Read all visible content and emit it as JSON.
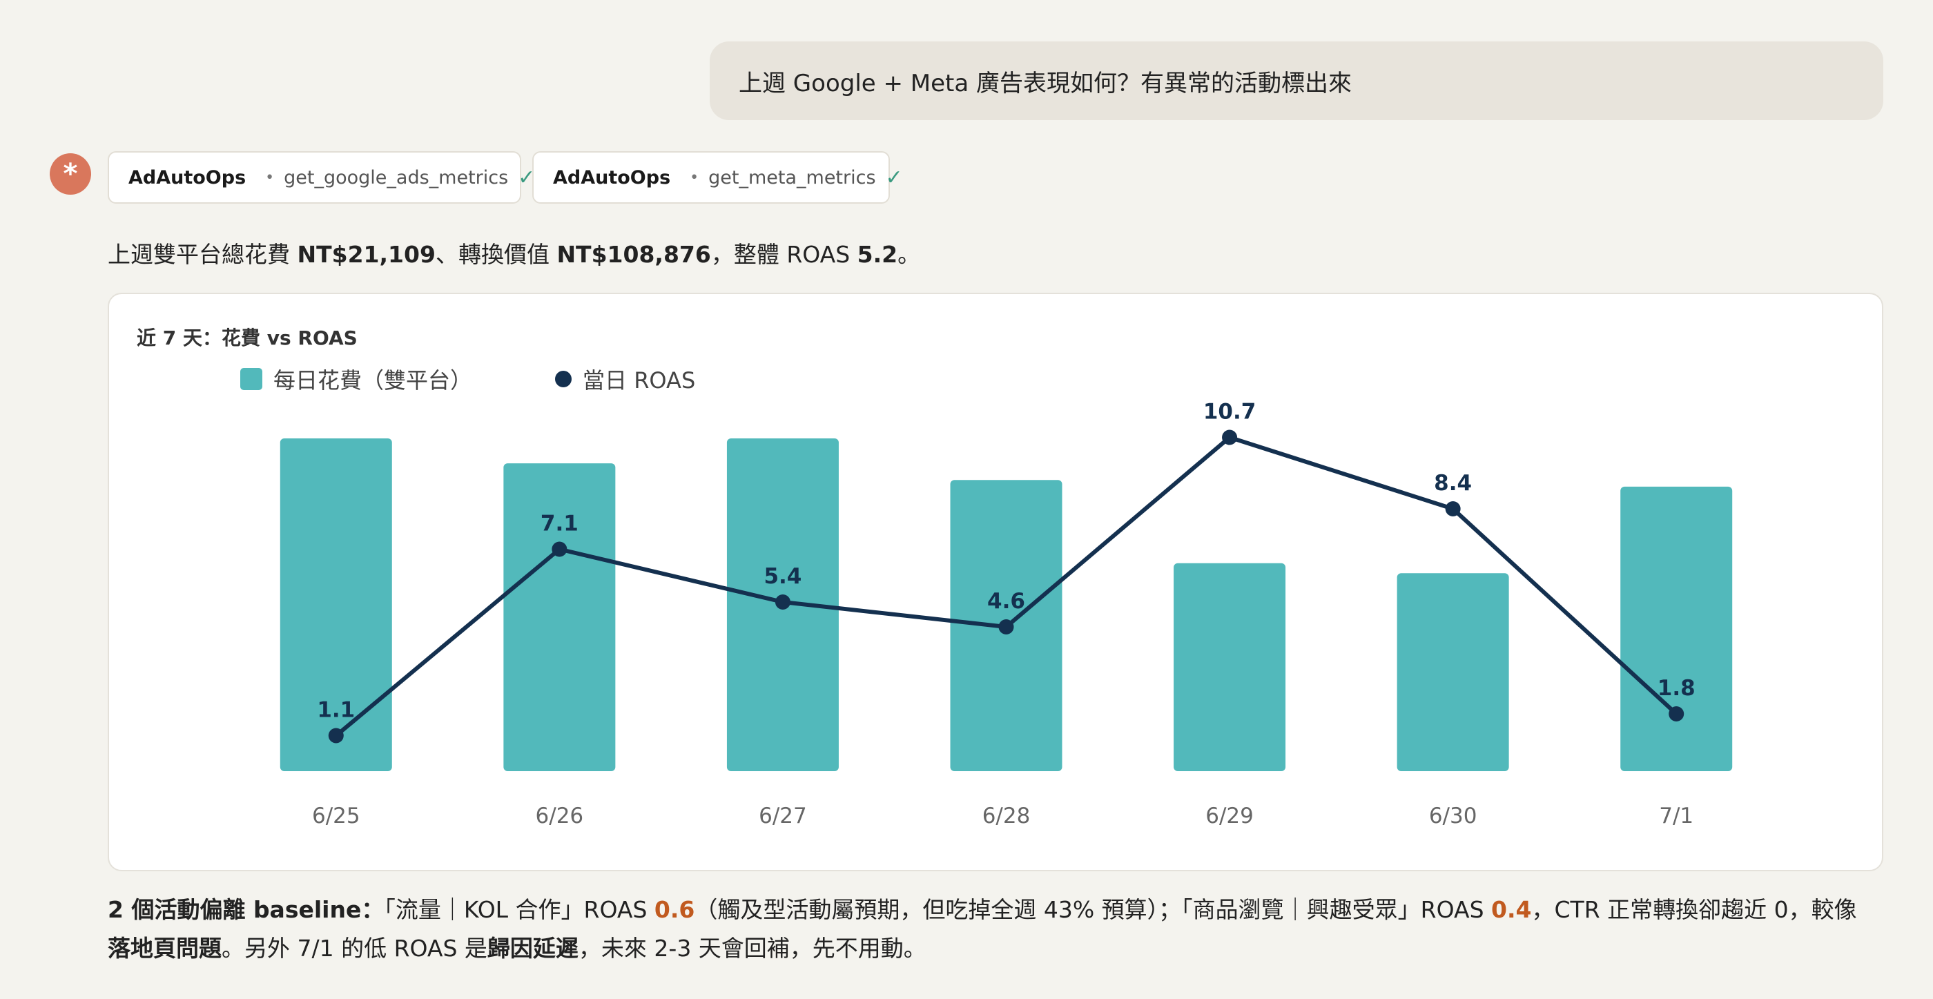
{
  "user_message": "上週 Google + Meta 廣告表現如何？有異常的活動標出來",
  "assistant": {
    "avatar_glyph": "*",
    "tool_calls": [
      {
        "app": "AdAutoOps",
        "function": "get_google_ads_metrics",
        "status": "✓"
      },
      {
        "app": "AdAutoOps",
        "function": "get_meta_metrics",
        "status": "✓"
      }
    ],
    "summary": {
      "prefix": "上週雙平台總花費 ",
      "spend": "NT$21,109",
      "mid": "、轉換價值 ",
      "value": "NT$108,876",
      "mid2": "，整體 ROAS ",
      "roas": "5.2",
      "suffix": "。"
    },
    "note": {
      "lead": "2 個活動偏離 baseline：",
      "p1": "「流量｜KOL 合作」ROAS ",
      "roas1": "0.6",
      "p2": "（觸及型活動屬預期，但吃掉全週 43% 預算）；「商品瀏覽｜興趣受眾」ROAS ",
      "roas2": "0.4",
      "p3": "，CTR 正常轉換卻趨近 0，較像",
      "b1": "落地頁問題",
      "p4": "。另外 7/1 的低 ROAS 是",
      "b2": "歸因延遲",
      "p5": "，未來 2-3 天會回補，先不用動。"
    }
  },
  "chart_data": {
    "type": "bar",
    "title": "近 7 天：花費 vs ROAS",
    "categories": [
      "6/25",
      "6/26",
      "6/27",
      "6/28",
      "6/29",
      "6/30",
      "7/1"
    ],
    "series": [
      {
        "name": "每日花費（雙平台）",
        "type": "bar",
        "color": "#52b9bb",
        "values": [
          4000,
          3700,
          4000,
          3500,
          2500,
          2380,
          3420
        ]
      },
      {
        "name": "當日 ROAS",
        "type": "line",
        "color": "#14304f",
        "values": [
          1.1,
          7.1,
          5.4,
          4.6,
          10.7,
          8.4,
          1.8
        ]
      }
    ],
    "bar_axis_ylim": [
      0,
      4000
    ],
    "line_axis_ylim": [
      0,
      12
    ],
    "grid": false,
    "legend_position": "top-left"
  }
}
